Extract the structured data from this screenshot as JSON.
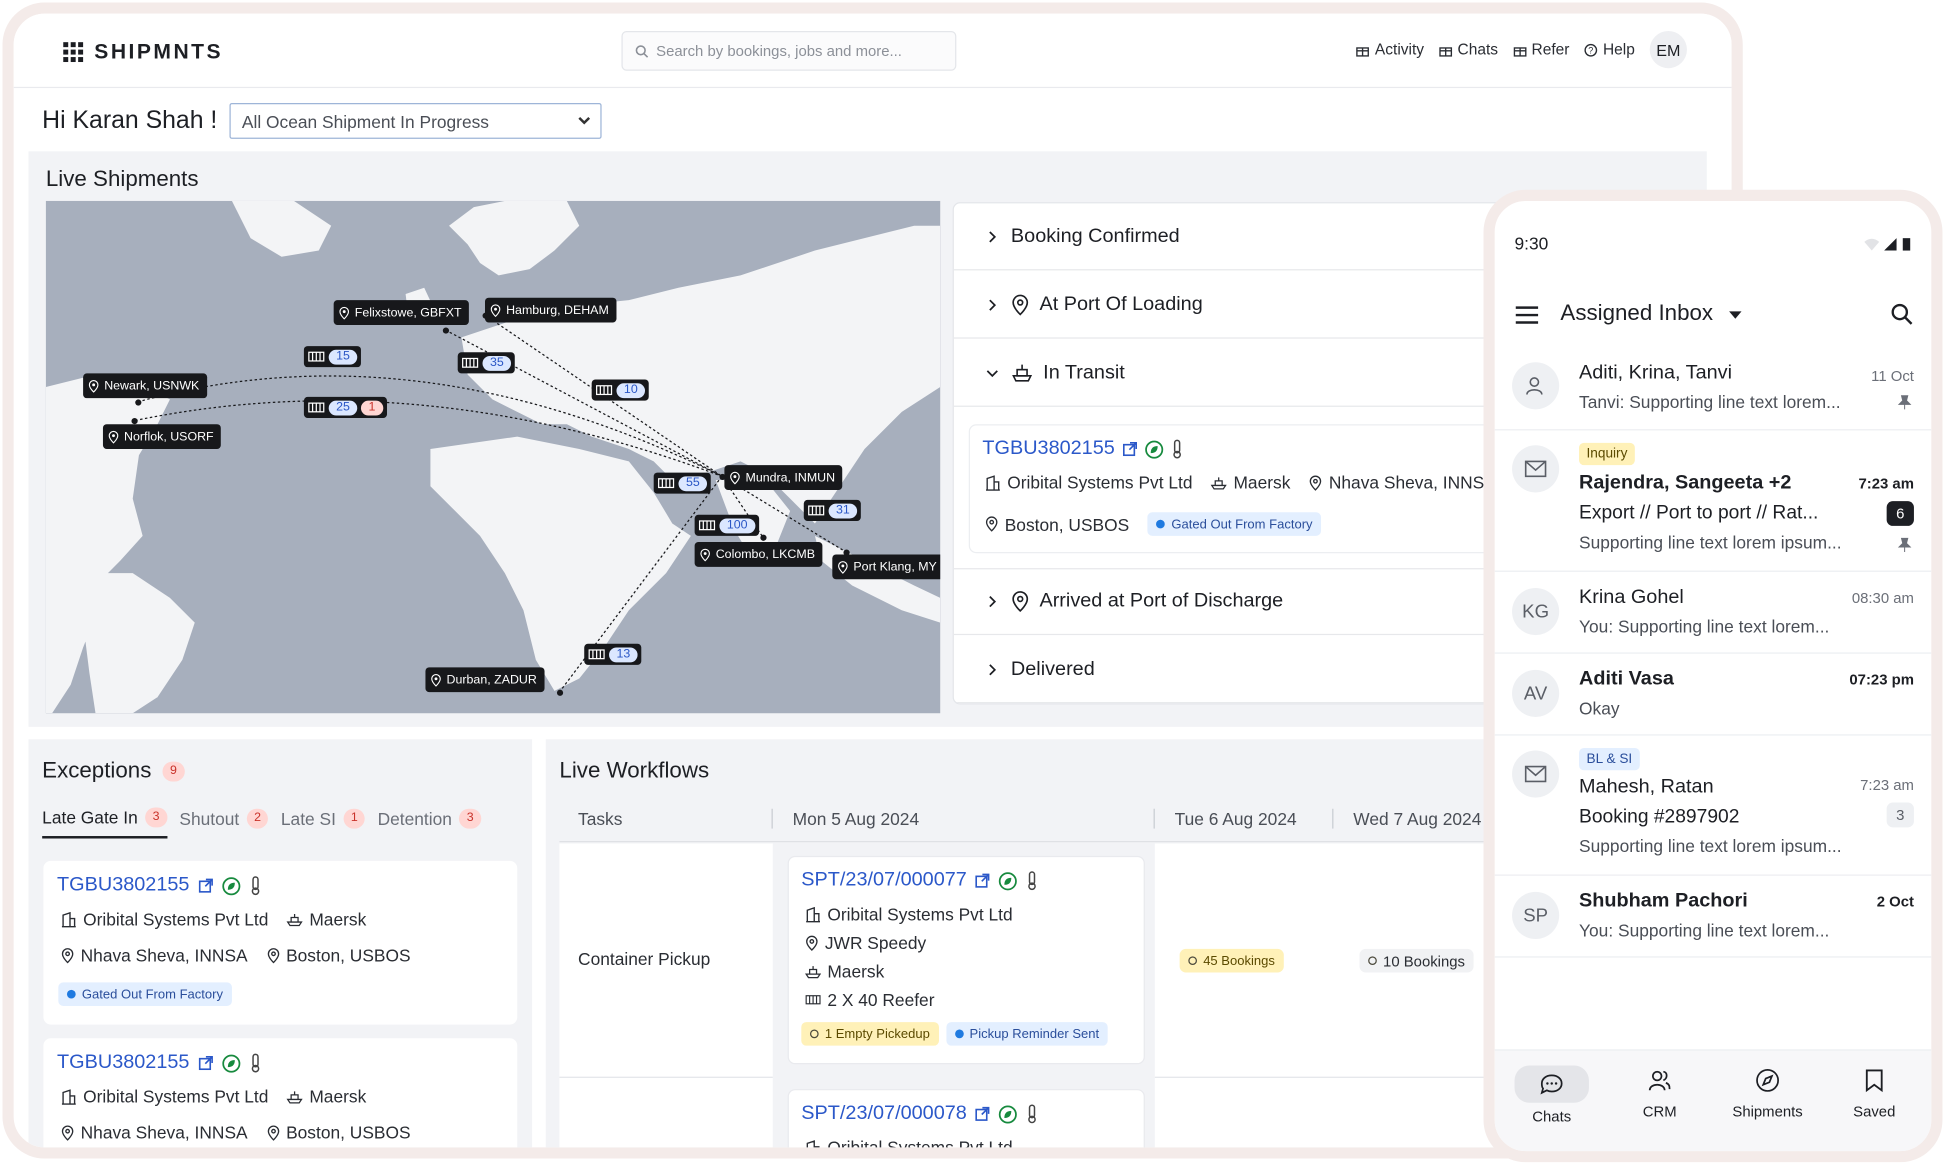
{
  "app": {
    "brand": "SHIPMNTS",
    "search_placeholder": "Search by bookings, jobs and more...",
    "nav": [
      "Activity",
      "Chats",
      "Refer",
      "Help"
    ],
    "avatar": "EM"
  },
  "greeting": "Hi Karan Shah !",
  "filter": {
    "selected": "All Ocean Shipment In Progress"
  },
  "live": {
    "title": "Live Shipments",
    "ports": [
      "Felixstowe, GBFXT",
      "Hamburg, DEHAM",
      "Newark, USNWK",
      "Norflok, USORF",
      "Mundra, INMUN",
      "Colombo, LKCMB",
      "Port Klang, MY",
      "Durban, ZADUR"
    ],
    "counts": [
      "15",
      "35",
      "10",
      "25",
      "1",
      "55",
      "100",
      "31",
      "13"
    ]
  },
  "stages": {
    "items": [
      "Booking Confirmed",
      "At Port Of Loading",
      "In Transit",
      "Arrived at Port of Discharge",
      "Delivered"
    ],
    "card": {
      "ref": "TGBU3802155",
      "company": "Oribital Systems Pvt Ltd",
      "carrier": "Maersk",
      "origin": "Nhava Sheva, INNSA",
      "dest": "Boston, USBOS",
      "status": "Gated Out From Factory"
    }
  },
  "exceptions": {
    "title": "Exceptions",
    "count": "9",
    "tabs": [
      {
        "label": "Late Gate In",
        "count": "3"
      },
      {
        "label": "Shutout",
        "count": "2"
      },
      {
        "label": "Late SI",
        "count": "1"
      },
      {
        "label": "Detention",
        "count": "3"
      }
    ],
    "cards": [
      {
        "ref": "TGBU3802155",
        "company": "Oribital Systems Pvt Ltd",
        "carrier": "Maersk",
        "origin": "Nhava Sheva, INNSA",
        "dest": "Boston, USBOS",
        "status": "Gated Out From Factory"
      },
      {
        "ref": "TGBU3802155",
        "company": "Oribital Systems Pvt Ltd",
        "carrier": "Maersk",
        "origin": "Nhava Sheva, INNSA",
        "dest": "Boston, USBOS"
      }
    ]
  },
  "workflows": {
    "title": "Live Workflows",
    "cols": [
      "Tasks",
      "Mon 5 Aug 2024",
      "Tue 6 Aug 2024",
      "Wed 7 Aug 2024"
    ],
    "task": "Container Pickup",
    "card1": {
      "ref": "SPT/23/07/000077",
      "company": "Oribital Systems Pvt Ltd",
      "transporter": "JWR Speedy",
      "carrier": "Maersk",
      "equipment": "2 X 40 Reefer",
      "tag1": "1 Empty Pickedup",
      "tag2": "Pickup Reminder Sent"
    },
    "card2": {
      "ref": "SPT/23/07/000078",
      "company": "Oribital Systems Pvt Ltd"
    },
    "tue_tag": "45 Bookings",
    "wed_tag": "10 Bookings"
  },
  "phone": {
    "time": "9:30",
    "title": "Assigned Inbox",
    "rows": [
      {
        "name": "Aditi, Krina, Tanvi",
        "sub": "Tanvi: Supporting line text lorem...",
        "time": "11 Oct"
      },
      {
        "pill": "Inquiry",
        "name": "Rajendra, Sangeeta +2",
        "sub1": "Export // Port to port // Rat...",
        "sub": "Supporting line text lorem ipsum...",
        "time": "7:23 am",
        "badge": "6"
      },
      {
        "initials": "KG",
        "name": "Krina Gohel",
        "sub": "You: Supporting line text lorem...",
        "time": "08:30 am"
      },
      {
        "initials": "AV",
        "name": "Aditi Vasa",
        "sub": "Okay",
        "time": "07:23 pm"
      },
      {
        "pill": "BL & SI",
        "name": "Mahesh, Ratan",
        "sub1": "Booking #2897902",
        "sub": "Supporting line text lorem ipsum...",
        "time": "7:23 am",
        "badge": "3"
      },
      {
        "initials": "SP",
        "name": "Shubham Pachori",
        "sub": "You: Supporting line text lorem...",
        "time": "2 Oct"
      }
    ],
    "tabs": [
      "Chats",
      "CRM",
      "Shipments",
      "Saved"
    ]
  }
}
